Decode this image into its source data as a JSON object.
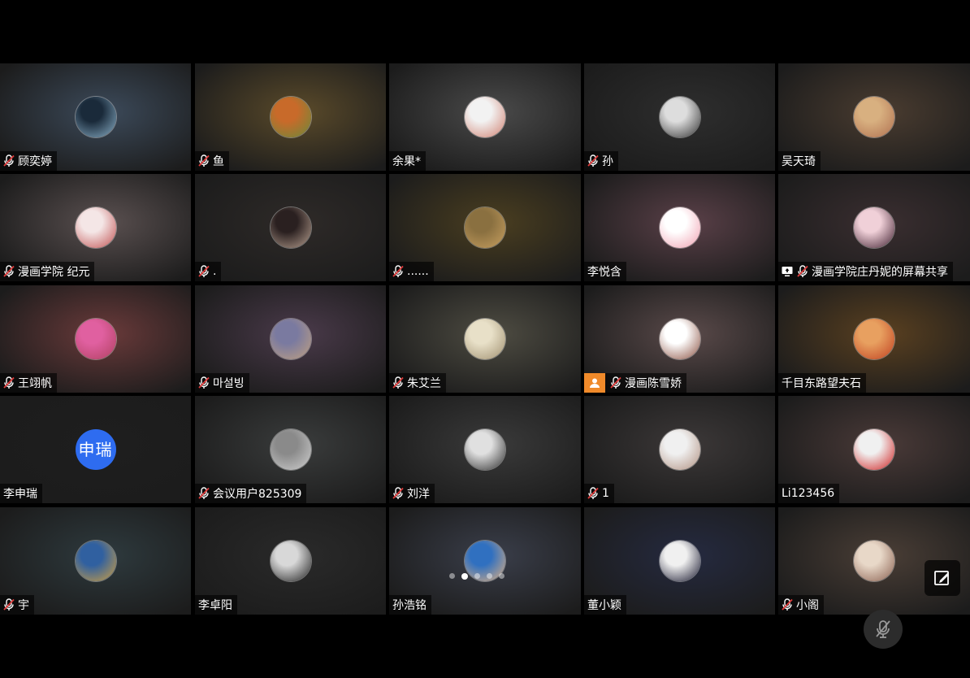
{
  "participants": [
    {
      "name": "顾奕婷",
      "muted": true,
      "bg": "#3c4a5a",
      "avatar": [
        "#1a2a3a",
        "#8ab0c8"
      ]
    },
    {
      "name": "鱼",
      "muted": true,
      "bg": "#5a4a2a",
      "avatar": [
        "#c86a2a",
        "#6a8a3a"
      ]
    },
    {
      "name": "余果*",
      "muted": false,
      "bg": "#4a4a4a",
      "avatar": [
        "#f2f2f2",
        "#d08070"
      ]
    },
    {
      "name": "孙",
      "muted": true,
      "bg": "#2e2e2e",
      "avatar": [
        "#ddd",
        "#333"
      ]
    },
    {
      "name": "吴天琦",
      "muted": false,
      "bg": "#4a3c30",
      "avatar": [
        "#d8b080",
        "#b07050"
      ]
    },
    {
      "name": "漫画学院 纪元",
      "muted": true,
      "bg": "#5a5050",
      "avatar": [
        "#f4e6e6",
        "#c05050"
      ]
    },
    {
      "name": ".",
      "muted": true,
      "bg": "#2e2a28",
      "avatar": [
        "#2a2020",
        "#b8a090"
      ]
    },
    {
      "name": "......",
      "muted": true,
      "bg": "#4a3e20",
      "avatar": [
        "#8a7040",
        "#c8a060"
      ]
    },
    {
      "name": "李悦含",
      "muted": false,
      "bg": "#5a4048",
      "avatar": [
        "#fff",
        "#f0a0b0"
      ]
    },
    {
      "name": "漫画学院庄丹妮的屏幕共享",
      "muted": true,
      "sharing": true,
      "bg": "#3a2e30",
      "avatar": [
        "#f0d0d8",
        "#402030"
      ]
    },
    {
      "name": "王翊帆",
      "muted": true,
      "bg": "#6a3a3a",
      "avatar": [
        "#e060a0",
        "#b04060"
      ]
    },
    {
      "name": "마설빙",
      "muted": true,
      "bg": "#4a3a4a",
      "avatar": [
        "#7a7aa0",
        "#c0a080"
      ]
    },
    {
      "name": "朱艾兰",
      "muted": true,
      "bg": "#4e4c42",
      "avatar": [
        "#e8e0c8",
        "#a09070"
      ]
    },
    {
      "name": "漫画陈雪娇",
      "muted": true,
      "host_icon": true,
      "bg": "#5a4a4a",
      "avatar": [
        "#fff",
        "#8a5040"
      ]
    },
    {
      "name": "千目东路望夫石",
      "muted": false,
      "bg": "#5a4020",
      "avatar": [
        "#e8a060",
        "#c04020"
      ]
    },
    {
      "name": "李申瑞",
      "muted": false,
      "bg": "#1e1e1e",
      "avatar_text": "申瑞"
    },
    {
      "name": "会议用户825309",
      "muted": true,
      "bg": "#3a3c3c",
      "avatar": [
        "#8a8a8a",
        "#d0d0d0"
      ]
    },
    {
      "name": "刘洋",
      "muted": true,
      "bg": "#3a3a3a",
      "avatar": [
        "#e0e0e0",
        "#303030"
      ]
    },
    {
      "name": "1",
      "muted": true,
      "bg": "#3c3838",
      "avatar": [
        "#f0f0f0",
        "#b09080"
      ]
    },
    {
      "name": "Li123456",
      "muted": false,
      "bg": "#4a3a38",
      "avatar": [
        "#f0f0f0",
        "#d02020"
      ]
    },
    {
      "name": "宇",
      "muted": true,
      "bg": "#2e3a3e",
      "avatar": [
        "#3060a0",
        "#d0a040"
      ]
    },
    {
      "name": "李卓阳",
      "muted": false,
      "bg": "#2a2a2a",
      "avatar": [
        "#d8d8d8",
        "#202020"
      ]
    },
    {
      "name": "孙浩铭",
      "muted": false,
      "bg": "#3a3e4a",
      "avatar": [
        "#3070c0",
        "#e0b080"
      ]
    },
    {
      "name": "董小颖",
      "muted": false,
      "bg": "#252a40",
      "avatar": [
        "#f0f0f0",
        "#1a1a30"
      ]
    },
    {
      "name": "小阁",
      "muted": true,
      "bg": "#4a3e36",
      "avatar": [
        "#e8d8c8",
        "#8a6050"
      ]
    }
  ],
  "pager": {
    "pages": 5,
    "active": 2
  },
  "icons": {
    "mic_muted": "mic-muted-icon",
    "screen_share": "screen-share-icon",
    "person": "person-icon",
    "edit": "edit-icon",
    "mute_all": "mic-off-icon"
  },
  "colors": {
    "mic_red": "#e03c3c",
    "host_orange": "#f08a2a",
    "avatar_blue": "#2e6cf0"
  }
}
